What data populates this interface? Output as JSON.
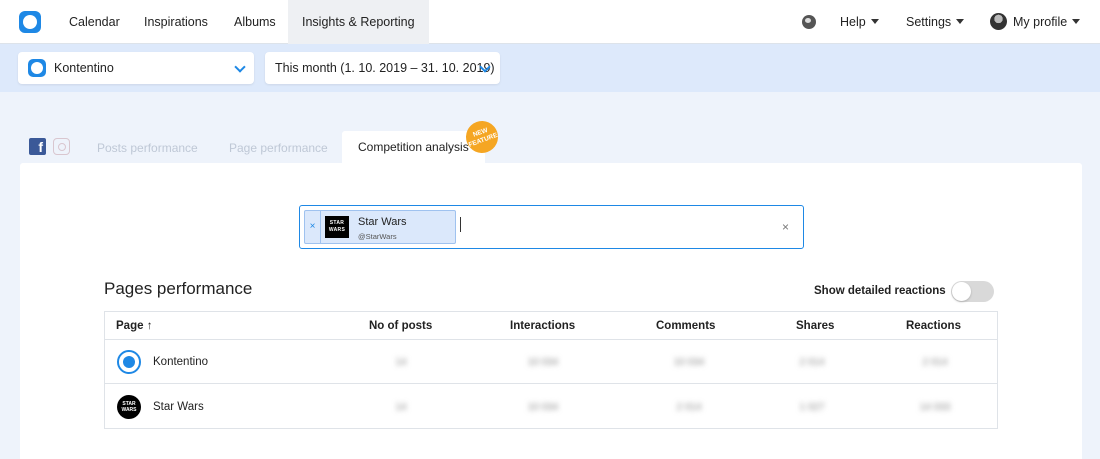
{
  "nav": {
    "items": [
      {
        "label": "Calendar"
      },
      {
        "label": "Inspirations"
      },
      {
        "label": "Albums"
      },
      {
        "label": "Insights & Reporting"
      }
    ],
    "help": "Help",
    "settings": "Settings",
    "profile": "My profile"
  },
  "filters": {
    "page": "Kontentino",
    "period": "This month (1. 10. 2019 – 31. 10. 2019)"
  },
  "tabs": {
    "posts": "Posts performance",
    "page": "Page performance",
    "competition": "Competition analysis",
    "badge": "NEW FEATURE"
  },
  "search": {
    "chip_name": "Star Wars",
    "chip_handle": "@StarWars",
    "chip_logo": "STAR WARS",
    "remove_label": "×",
    "clear_label": "×"
  },
  "section": {
    "title": "Pages performance",
    "toggle_label": "Show detailed reactions"
  },
  "table": {
    "headers": [
      "Page",
      "No of posts",
      "Interactions",
      "Comments",
      "Shares",
      "Reactions"
    ],
    "sort_arrow": "↑",
    "rows": [
      {
        "page": "Kontentino",
        "posts": "14",
        "interactions": "10 034",
        "comments": "10 034",
        "shares": "2 014",
        "reactions": "2 014"
      },
      {
        "page": "Star Wars",
        "posts": "14",
        "interactions": "10 034",
        "comments": "2 014",
        "shares": "1 027",
        "reactions": "14 033"
      }
    ]
  },
  "colors": {
    "accent": "#1e88e5",
    "badge": "#f5a623"
  }
}
